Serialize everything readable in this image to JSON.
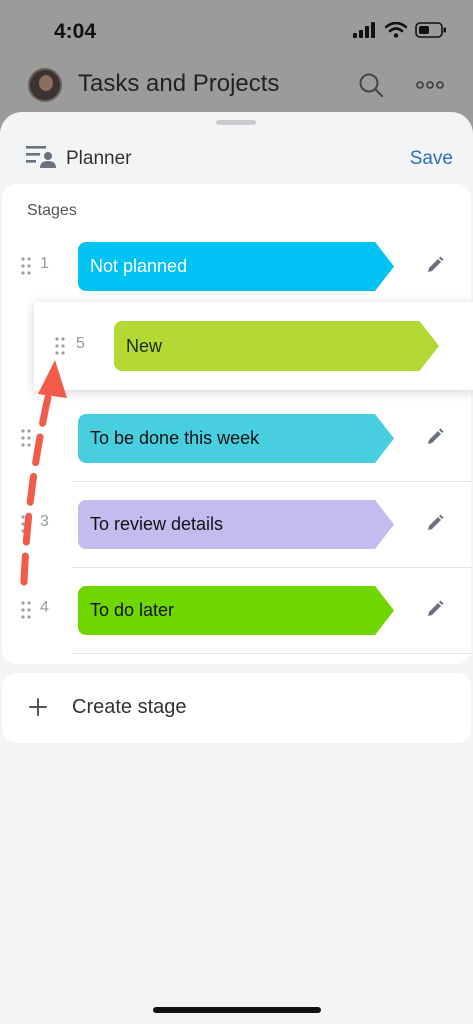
{
  "status_bar": {
    "time": "4:04"
  },
  "background_app": {
    "title": "Tasks and Projects"
  },
  "sheet": {
    "title": "Planner",
    "save_label": "Save",
    "stages_label": "Stages",
    "create_label": "Create stage"
  },
  "stages": [
    {
      "number": "1",
      "label": "Not planned",
      "color": "#00c2f3",
      "text_color": "#ffffff"
    },
    {
      "number": "",
      "label": "To be done this week",
      "color": "#47cfe0",
      "text_color": "#111111"
    },
    {
      "number": "3",
      "label": "To review details",
      "color": "#c5bbee",
      "text_color": "#111111"
    },
    {
      "number": "4",
      "label": "To do later",
      "color": "#6fd600",
      "text_color": "#111111"
    }
  ],
  "dragging_stage": {
    "number": "5",
    "label": "New",
    "color": "#b2d934",
    "text_color": "#1f2b10"
  },
  "colors": {
    "accent": "#2f6fb5",
    "arrow": "#f25a4a"
  },
  "icons": [
    "signal-icon",
    "wifi-icon",
    "battery-icon",
    "search-icon",
    "more-icon",
    "planner-icon",
    "drag-handle-icon",
    "edit-icon",
    "plus-icon"
  ]
}
